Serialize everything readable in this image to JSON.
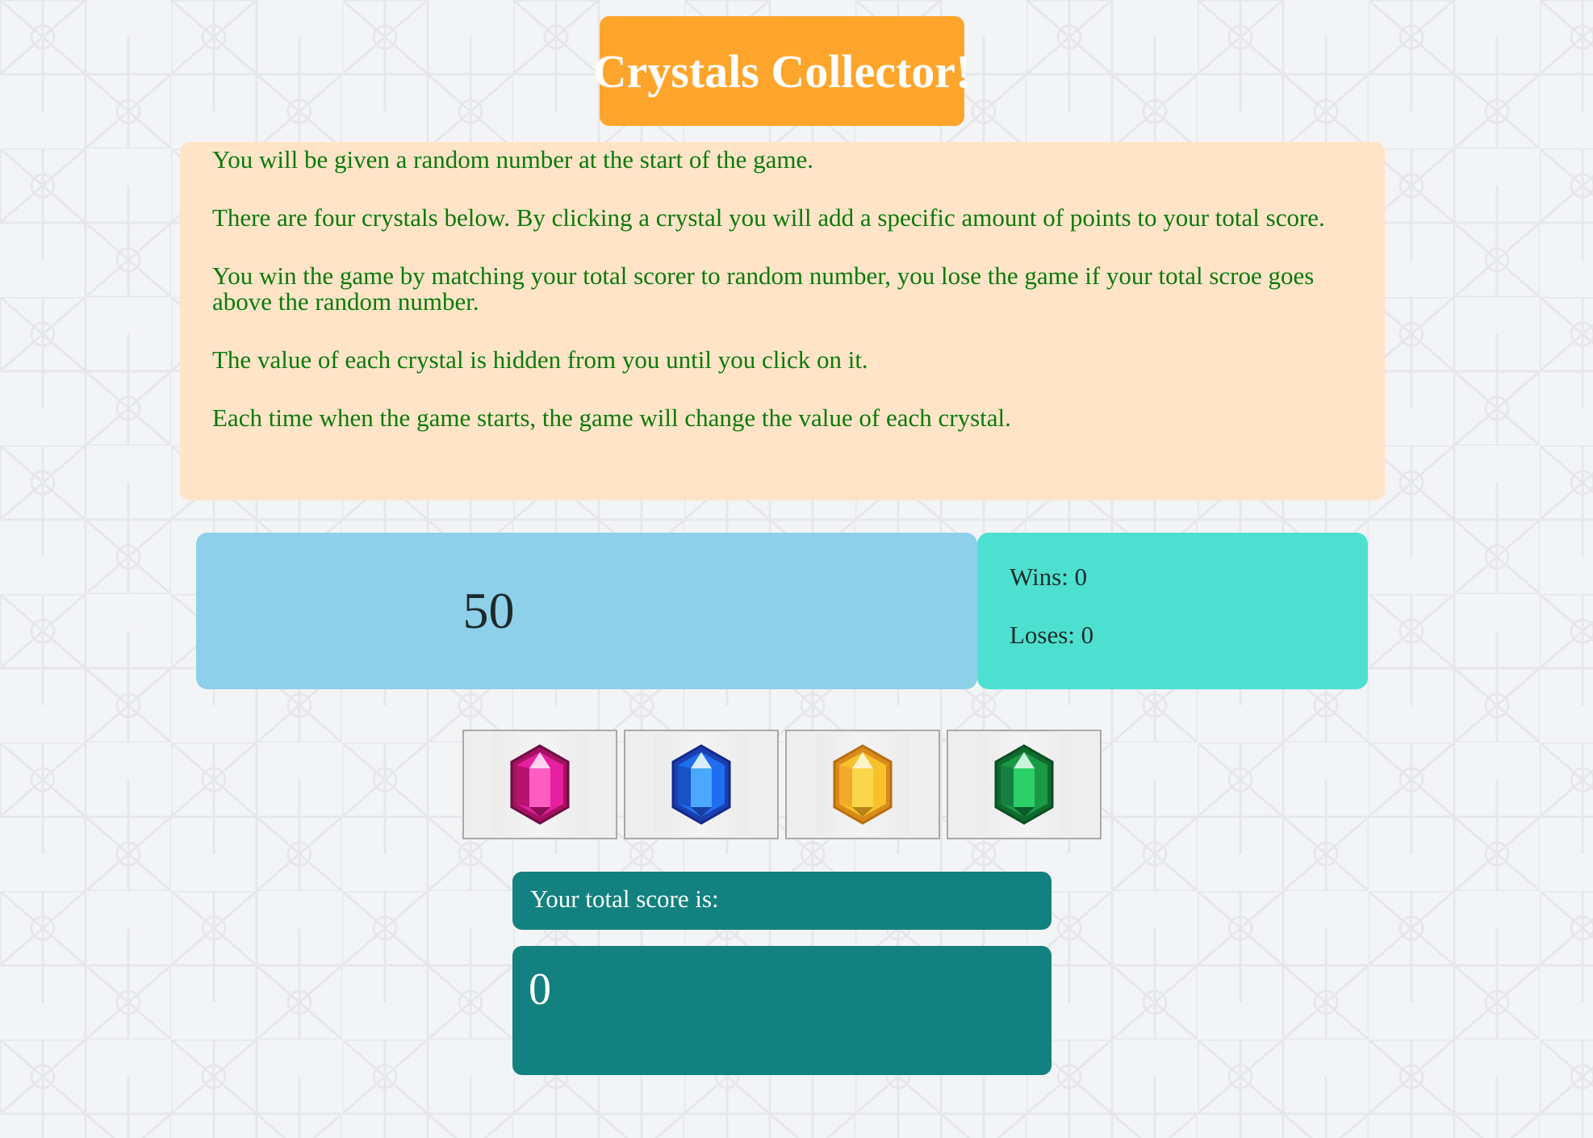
{
  "title": "Crystals Collector!",
  "instructions": [
    "You will be given a random number at the start of the game.",
    "There are four crystals below. By clicking a crystal you will add a specific amount of points to your total score.",
    "You win the game by matching your total scorer to random number, you lose the game if your total scroe goes above the random number.",
    "The value of each crystal is hidden from you until you click on it.",
    "Each time when the game starts, the game will change the value of each crystal."
  ],
  "target_number": "50",
  "stats": {
    "wins": "Wins: 0",
    "losses": "Loses: 0"
  },
  "crystals": [
    {
      "name": "pink-crystal-icon",
      "color": "#e81ea0"
    },
    {
      "name": "blue-crystal-icon",
      "color": "#2a8cf0"
    },
    {
      "name": "yellow-crystal-icon",
      "color": "#f6c12a"
    },
    {
      "name": "green-crystal-icon",
      "color": "#1fae4c"
    }
  ],
  "score": {
    "label": "Your total score is:",
    "value": "0"
  },
  "colors": {
    "title_bg": "#ffa52b",
    "instructions_bg": "#ffe4c8",
    "instructions_text": "#0b7a0b",
    "target_bg": "#8ecfe9",
    "stats_bg": "#4de0d0",
    "score_bg": "#128180"
  }
}
